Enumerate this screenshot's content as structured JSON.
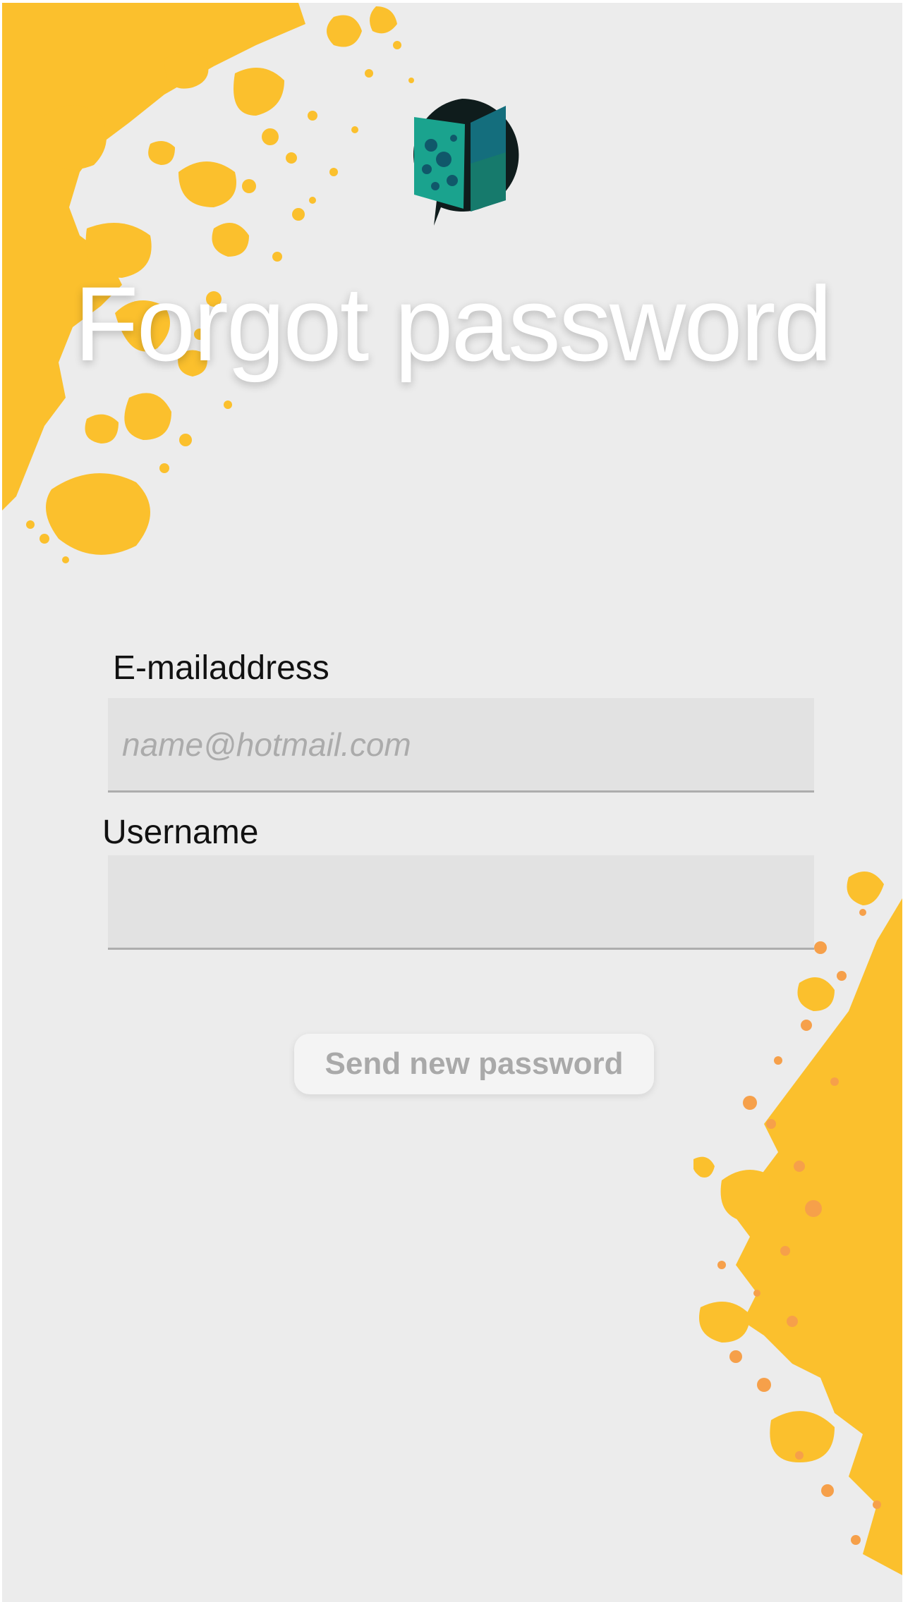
{
  "page": {
    "title": "Forgot password"
  },
  "form": {
    "email_label": "E-mailaddress",
    "email_placeholder": "name@hotmail.com",
    "email_value": "",
    "username_label": "Username",
    "username_placeholder": "",
    "username_value": ""
  },
  "actions": {
    "send_label": "Send new password"
  },
  "icons": {
    "logo": "book-speech-bubble-logo",
    "decoration": "paint-splash"
  },
  "colors": {
    "background": "#ececec",
    "splash_primary": "#fbc02d",
    "splash_secondary": "#f6a04a",
    "logo_dark": "#0f1c1c",
    "logo_teal": "#1aa38e",
    "logo_blue": "#146e7d"
  }
}
